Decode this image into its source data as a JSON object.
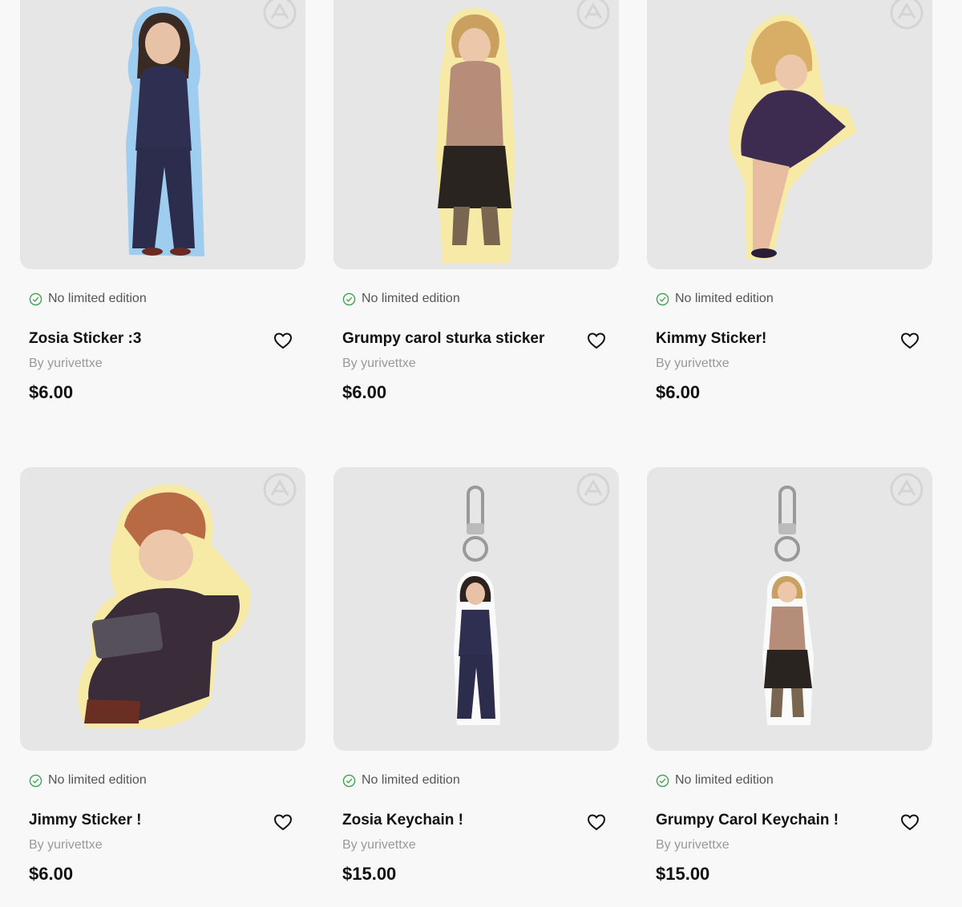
{
  "products": [
    {
      "edition": "No limited edition",
      "title": "Zosia Sticker :3",
      "author": "By yurivettxe",
      "price": "$6.00"
    },
    {
      "edition": "No limited edition",
      "title": "Grumpy carol sturka sticker",
      "author": "By yurivettxe",
      "price": "$6.00"
    },
    {
      "edition": "No limited edition",
      "title": "Kimmy Sticker!",
      "author": "By yurivettxe",
      "price": "$6.00"
    },
    {
      "edition": "No limited edition",
      "title": "Jimmy Sticker !",
      "author": "By yurivettxe",
      "price": "$6.00"
    },
    {
      "edition": "No limited edition",
      "title": "Zosia Keychain !",
      "author": "By yurivettxe",
      "price": "$15.00"
    },
    {
      "edition": "No limited edition",
      "title": "Grumpy Carol Keychain !",
      "author": "By yurivettxe",
      "price": "$15.00"
    }
  ],
  "icons": {
    "edition": "check-circle-icon",
    "favorite": "heart-icon",
    "watermark": "store-logo-watermark"
  },
  "colors": {
    "background": "#f8f8f8",
    "thumbnail": "#e6e6e6",
    "check": "#3aa04a",
    "author": "#999999"
  }
}
